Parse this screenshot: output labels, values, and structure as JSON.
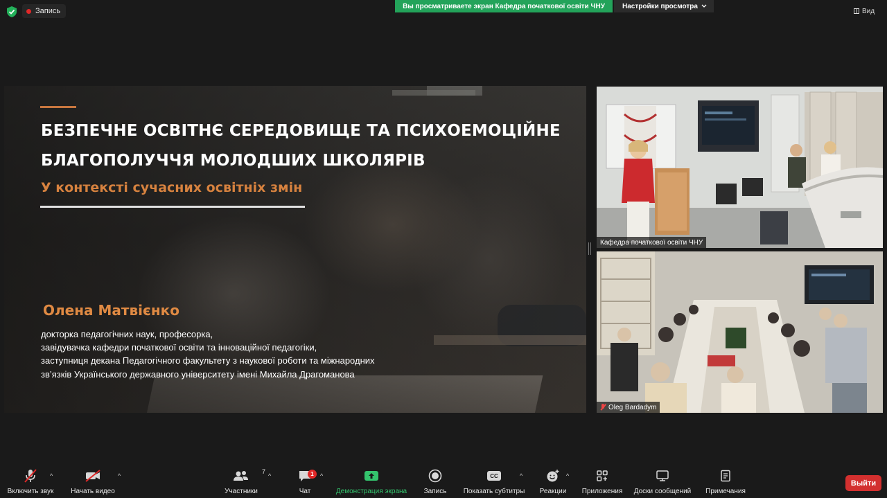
{
  "topbar": {
    "record_label": "Запись",
    "share_banner": "Вы просматриваете экран Кафедра початкової освіти ЧНУ",
    "view_settings": "Настройки просмотра",
    "view_label": "Вид"
  },
  "slide": {
    "title_line1": "Безпечне освітнє середовище та психоемоційне",
    "title_line2": "благополуччя молодших школярів",
    "subtitle": "У контексті сучасних освітніх змін",
    "speaker": "Олена Матвієнко",
    "bio": [
      "докторка педагогічних наук, професорка,",
      "завідувачка кафедри початкової освіти та інноваційної педагогіки,",
      "заступниця декана Педагогічного факультету з наукової роботи та міжнародних",
      "зв’язків  Українського державного університету імені Михайла Драгоманова"
    ],
    "accent_color": "#d7823f"
  },
  "participants": [
    {
      "name": "Кафедра початкової освіти ЧНУ",
      "muted": false
    },
    {
      "name": "Oleg Bardadym",
      "muted": true
    }
  ],
  "toolbar": {
    "mute_label": "Включить звук",
    "video_label": "Начать видео",
    "participants_label": "Участники",
    "participants_count": "7",
    "chat_label": "Чат",
    "chat_badge": "1",
    "share_label": "Демонстрация экрана",
    "record_label": "Запись",
    "captions_label": "Показать субтитры",
    "captions_icon_text": "CC",
    "reactions_label": "Реакции",
    "apps_label": "Приложения",
    "whiteboard_label": "Доски сообщений",
    "notes_label": "Примечания",
    "leave_label": "Выйти",
    "share_color": "#34c46d",
    "leave_color": "#d3302f"
  }
}
